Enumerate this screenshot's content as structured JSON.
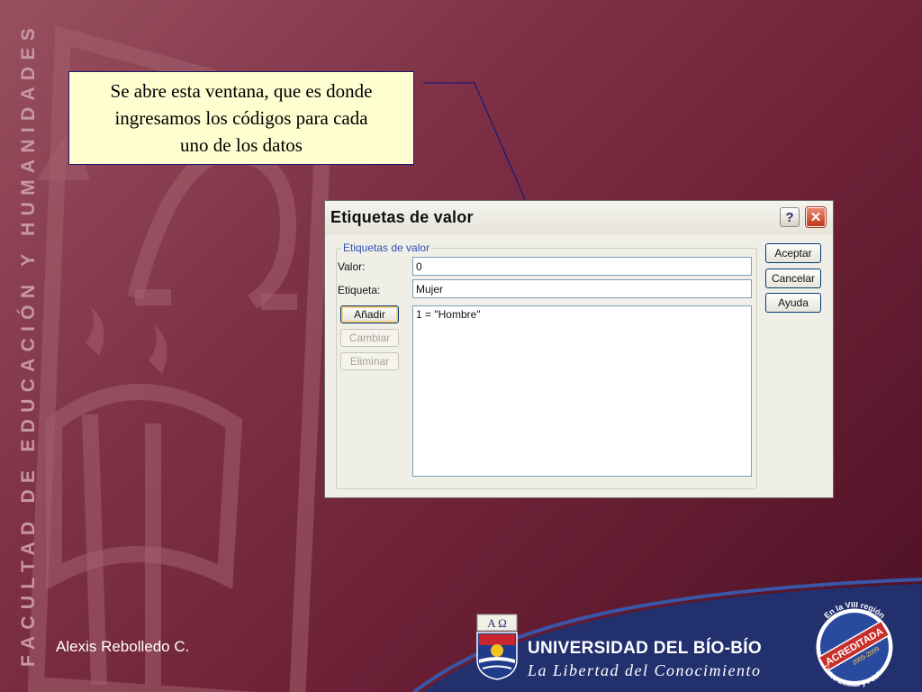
{
  "slide": {
    "vertical_title": "FACULTAD DE EDUCACIÓN Y HUMANIDADES",
    "author": "Alexis Rebolledo C."
  },
  "callout": {
    "lines": [
      "Se abre esta ventana, que es donde",
      "ingresamos los códigos para cada",
      "uno de los datos"
    ]
  },
  "dialog": {
    "title": "Etiquetas de valor",
    "help_glyph": "?",
    "close_glyph": "✕",
    "group_title": "Etiquetas de valor",
    "valor_label": "Valor:",
    "valor_value": "0",
    "etiqueta_label": "Etiqueta:",
    "etiqueta_value": "Mujer",
    "list_items": [
      "1 = \"Hombre\""
    ],
    "buttons": {
      "anadir": "Añadir",
      "cambiar": "Cambiar",
      "eliminar": "Eliminar",
      "aceptar": "Aceptar",
      "cancelar": "Cancelar",
      "ayuda": "Ayuda"
    }
  },
  "footer": {
    "university_name": "UNIVERSIDAD DEL BÍO-BÍO",
    "motto": "La Libertad del Conocimiento",
    "crest_letters": "A Ω",
    "badge_top": "En la VIII región",
    "badge_middle": "ACREDITADA",
    "badge_years": "2005-2009",
    "badge_bottom": "Única Estatal y Pública"
  },
  "colors": {
    "background": "#7e3146",
    "callout_fill": "#fefed0",
    "footer_blue": "#22306e",
    "badge_red": "#c72f2c"
  }
}
